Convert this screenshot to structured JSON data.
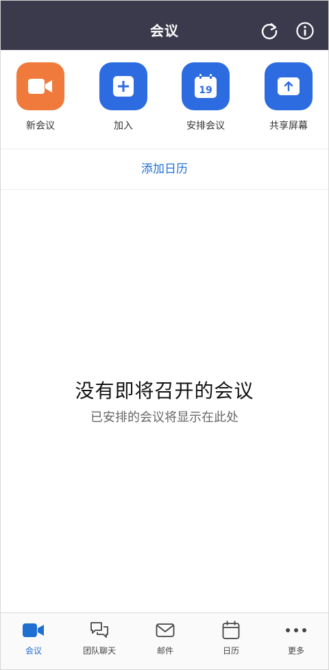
{
  "header": {
    "title": "会议",
    "background": "#3b3a4c",
    "icons": [
      "refresh-icon",
      "info-icon"
    ]
  },
  "actions": [
    {
      "label": "新会议",
      "color": "#ef7a3b",
      "icon": "video-camera-icon"
    },
    {
      "label": "加入",
      "color": "#2d6be0",
      "icon": "plus-icon"
    },
    {
      "label": "安排会议",
      "color": "#2d6be0",
      "icon": "calendar-icon",
      "calendar_day": "19"
    },
    {
      "label": "共享屏幕",
      "color": "#2d6be0",
      "icon": "share-upload-icon"
    }
  ],
  "add_calendar": {
    "label": "添加日历"
  },
  "empty_state": {
    "title": "没有即将召开的会议",
    "subtitle": "已安排的会议将显示在此处"
  },
  "tabs": [
    {
      "label": "会议",
      "icon": "video-camera-icon",
      "active": true
    },
    {
      "label": "团队聊天",
      "icon": "chat-bubbles-icon",
      "active": false
    },
    {
      "label": "邮件",
      "icon": "envelope-icon",
      "active": false
    },
    {
      "label": "日历",
      "icon": "calendar-icon",
      "active": false
    },
    {
      "label": "更多",
      "icon": "more-dots-icon",
      "active": false
    }
  ],
  "colors": {
    "accent": "#1e6fd1",
    "orange": "#ef7a3b",
    "blue": "#2d6be0"
  }
}
